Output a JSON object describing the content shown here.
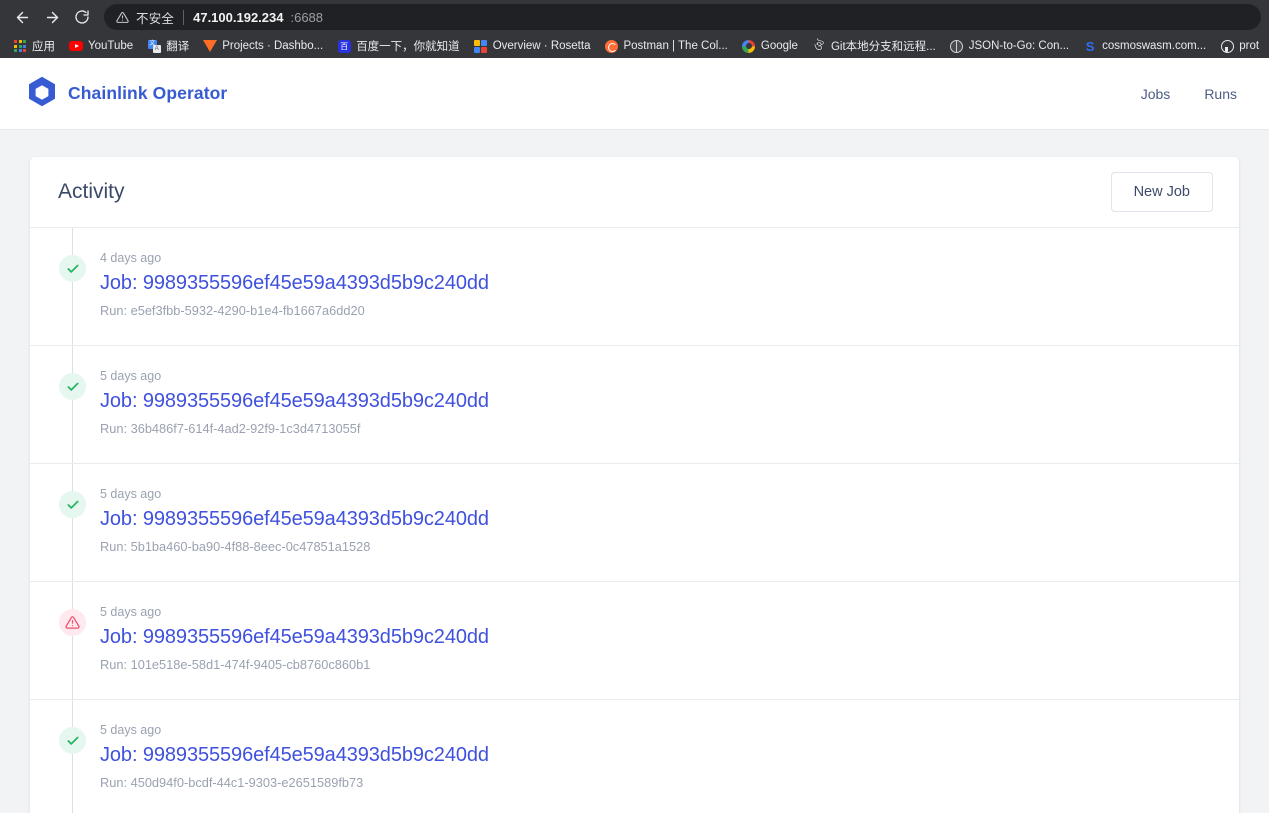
{
  "browser": {
    "nav": {
      "back_label": "Back",
      "forward_label": "Forward",
      "reload_label": "Reload"
    },
    "omnibox": {
      "security_icon": "warning-triangle-icon",
      "security_label": "不安全",
      "url_host": "47.100.192.234",
      "url_port": ":6688"
    },
    "bookmarks": [
      {
        "label": "应用",
        "icon": "apps-grid-icon"
      },
      {
        "label": "YouTube",
        "icon": "youtube-icon"
      },
      {
        "label": "翻译",
        "icon": "google-translate-icon"
      },
      {
        "label": "Projects · Dashbo...",
        "icon": "gitlab-icon"
      },
      {
        "label": "百度一下，你就知道",
        "icon": "baidu-icon"
      },
      {
        "label": "Overview · Rosetta",
        "icon": "rosetta-icon"
      },
      {
        "label": "Postman | The Col...",
        "icon": "postman-icon"
      },
      {
        "label": "Google",
        "icon": "google-icon"
      },
      {
        "label": "Git本地分支和远程...",
        "icon": "git-icon"
      },
      {
        "label": "JSON-to-Go: Con...",
        "icon": "globe-icon"
      },
      {
        "label": "cosmoswasm.com...",
        "icon": "cosmos-icon"
      },
      {
        "label": "prot",
        "icon": "github-icon"
      }
    ]
  },
  "app": {
    "brand": {
      "name": "Chainlink Operator",
      "logo_icon": "chainlink-hexagon-icon",
      "color": "#375bd2"
    },
    "nav": [
      {
        "label": "Jobs"
      },
      {
        "label": "Runs"
      }
    ]
  },
  "activity": {
    "title": "Activity",
    "new_job_label": "New Job",
    "items": [
      {
        "status": "ok",
        "status_icon": "check-icon",
        "time": "4 days ago",
        "job": "Job: 9989355596ef45e59a4393d5b9c240dd",
        "run": "Run: e5ef3fbb-5932-4290-b1e4-fb1667a6dd20"
      },
      {
        "status": "ok",
        "status_icon": "check-icon",
        "time": "5 days ago",
        "job": "Job: 9989355596ef45e59a4393d5b9c240dd",
        "run": "Run: 36b486f7-614f-4ad2-92f9-1c3d4713055f"
      },
      {
        "status": "ok",
        "status_icon": "check-icon",
        "time": "5 days ago",
        "job": "Job: 9989355596ef45e59a4393d5b9c240dd",
        "run": "Run: 5b1ba460-ba90-4f88-8eec-0c47851a1528"
      },
      {
        "status": "err",
        "status_icon": "warning-triangle-icon",
        "time": "5 days ago",
        "job": "Job: 9989355596ef45e59a4393d5b9c240dd",
        "run": "Run: 101e518e-58d1-474f-9405-cb8760c860b1"
      },
      {
        "status": "ok",
        "status_icon": "check-icon",
        "time": "5 days ago",
        "job": "Job: 9989355596ef45e59a4393d5b9c240dd",
        "run": "Run: 450d94f0-bcdf-44c1-9303-e2651589fb73"
      }
    ],
    "colors": {
      "link": "#3f51dd",
      "ok": "#28b463",
      "err": "#f06292"
    }
  }
}
